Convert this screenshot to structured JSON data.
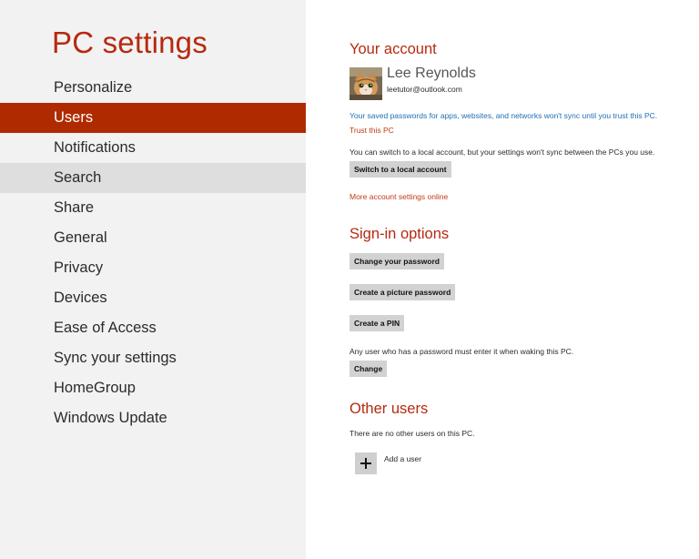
{
  "app": {
    "title": "PC settings"
  },
  "nav": {
    "items": [
      {
        "label": "Personalize",
        "state": ""
      },
      {
        "label": "Users",
        "state": "selected"
      },
      {
        "label": "Notifications",
        "state": ""
      },
      {
        "label": "Search",
        "state": "hover"
      },
      {
        "label": "Share",
        "state": ""
      },
      {
        "label": "General",
        "state": ""
      },
      {
        "label": "Privacy",
        "state": ""
      },
      {
        "label": "Devices",
        "state": ""
      },
      {
        "label": "Ease of Access",
        "state": ""
      },
      {
        "label": "Sync your settings",
        "state": ""
      },
      {
        "label": "HomeGroup",
        "state": ""
      },
      {
        "label": "Windows Update",
        "state": ""
      }
    ]
  },
  "account": {
    "heading": "Your account",
    "name": "Lee Reynolds",
    "email": "leetutor@outlook.com",
    "avatar_icon": "kitten-photo",
    "trust_message": "Your saved passwords for apps, websites, and networks won't sync until you trust this PC.",
    "trust_link": "Trust this PC",
    "local_message": "You can switch to a local account, but your settings won't sync between the PCs you use.",
    "switch_button": "Switch to a local account",
    "more_link": "More account settings online"
  },
  "signin": {
    "heading": "Sign-in options",
    "change_password_button": "Change your password",
    "picture_password_button": "Create a picture password",
    "pin_button": "Create a PIN",
    "wake_message": "Any user who has a password must enter it when waking this PC.",
    "change_button": "Change"
  },
  "other_users": {
    "heading": "Other users",
    "message": "There are no other users on this PC.",
    "add_label": "Add a user",
    "add_icon": "plus-icon"
  },
  "colors": {
    "accent": "#b02a00",
    "heading": "#b62a10",
    "link_blue": "#1f6fb6",
    "sidebar_bg": "#f2f2f2",
    "hover_bg": "#dedede",
    "button_bg": "#d2d2d2"
  }
}
